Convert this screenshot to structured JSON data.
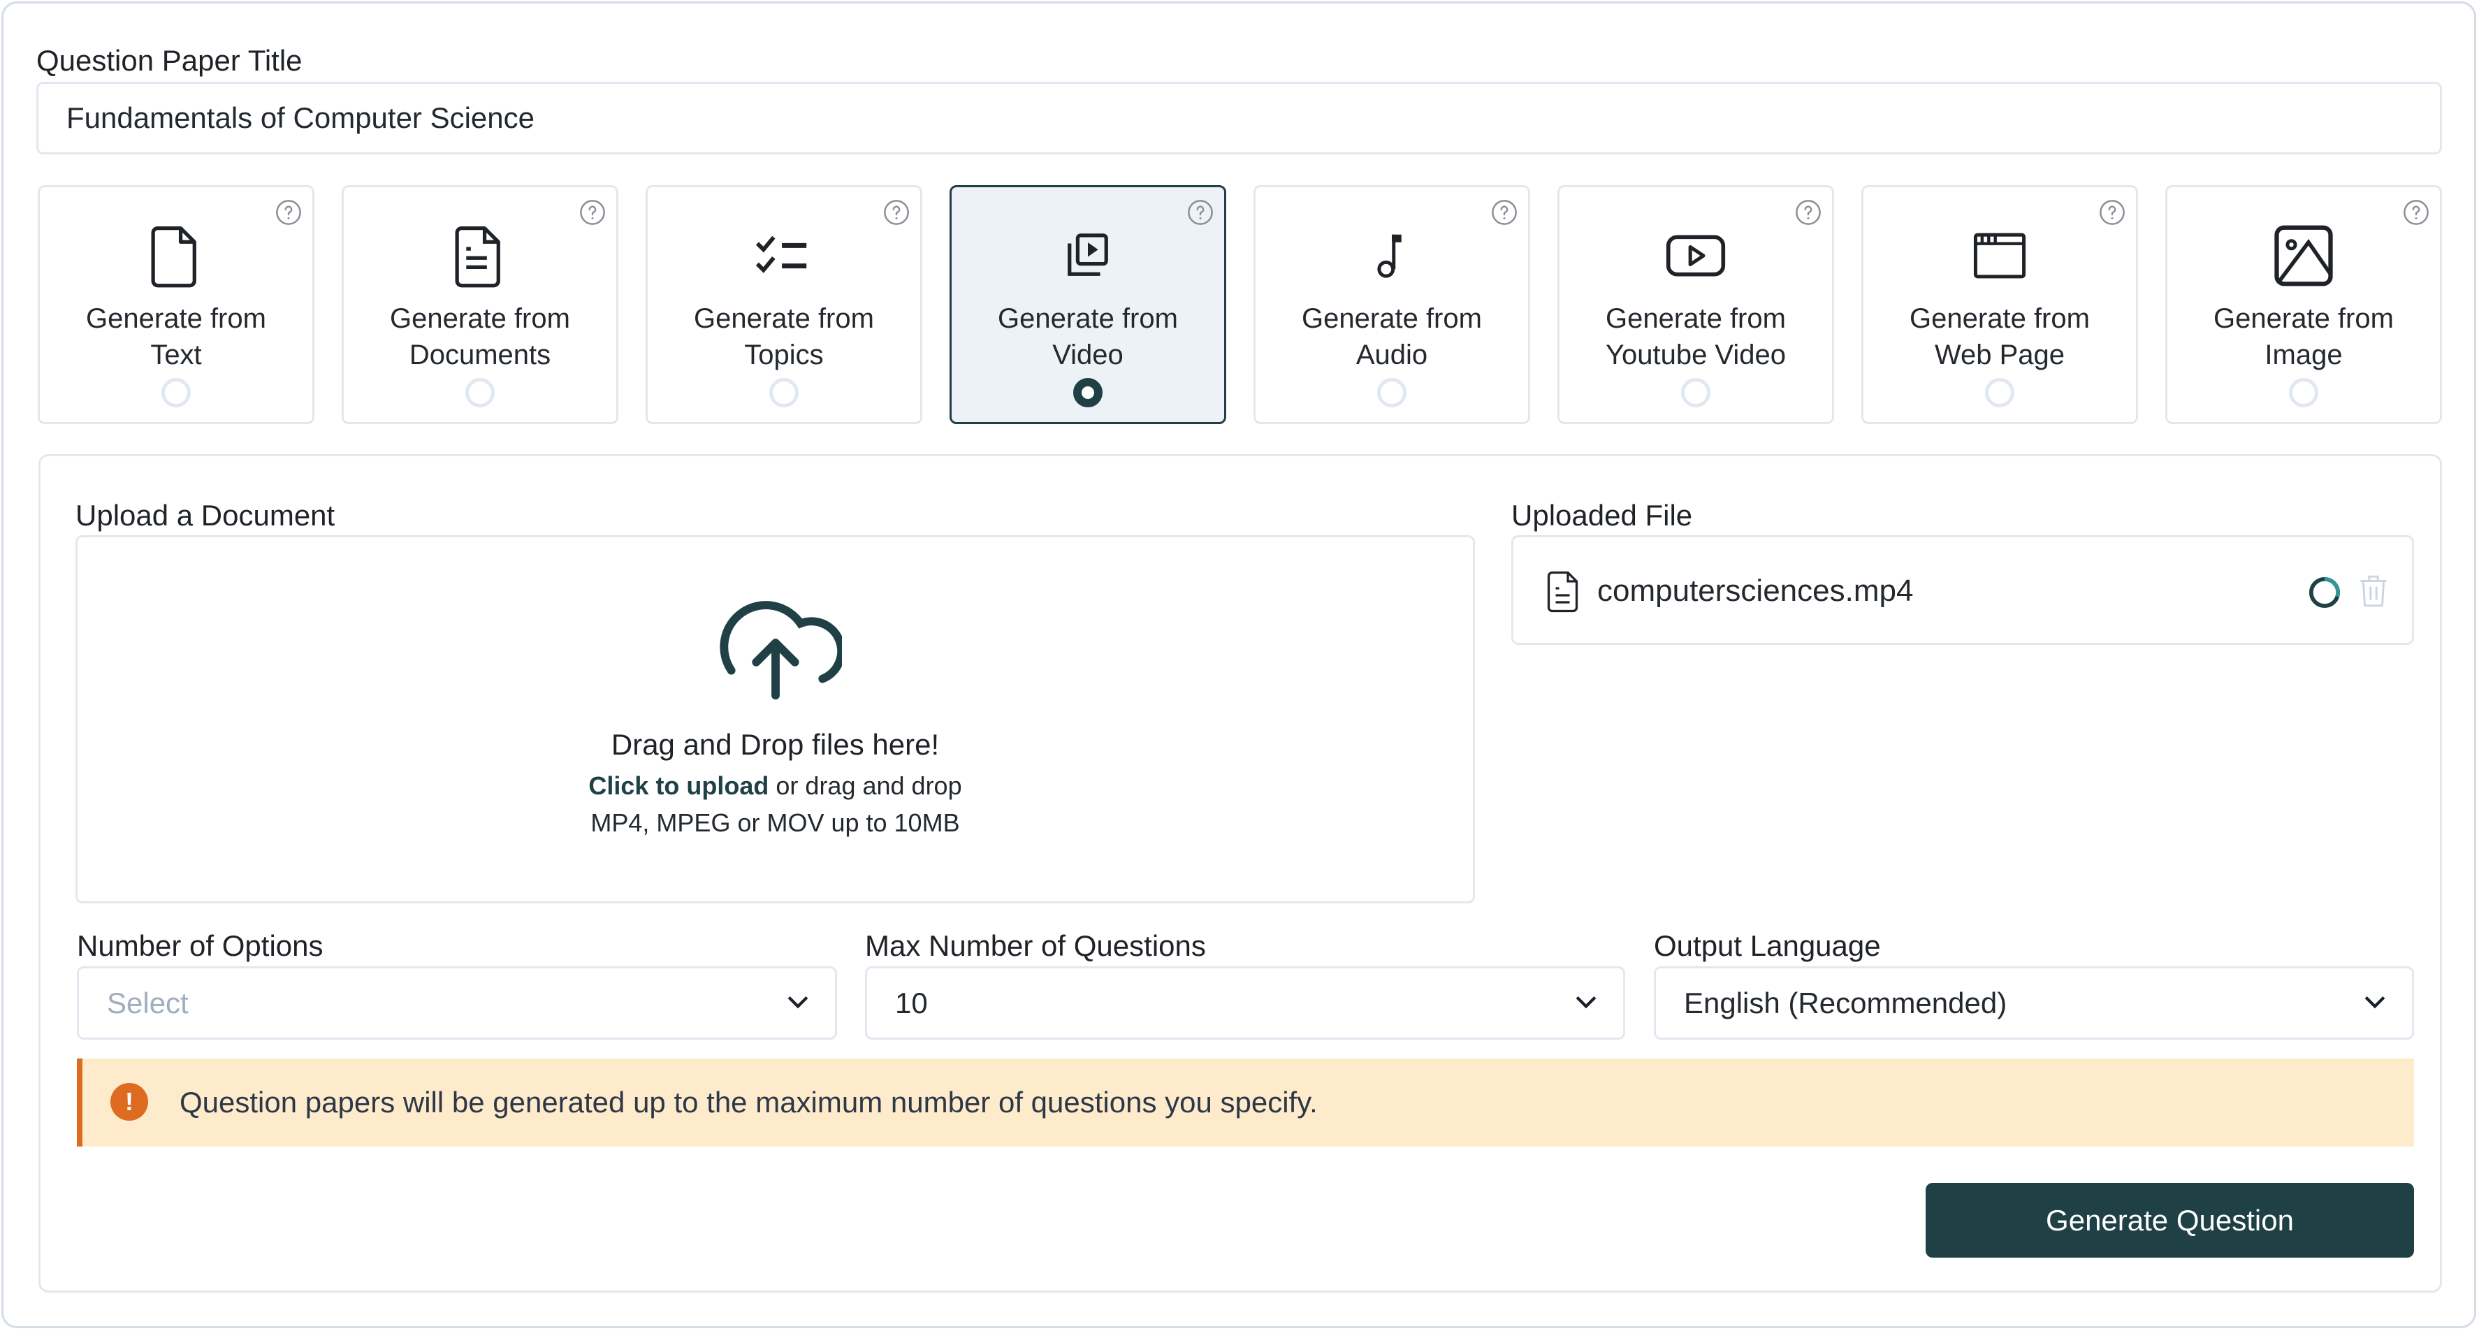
{
  "form": {
    "title_label": "Question Paper Title",
    "title_value": "Fundamentals of Computer Science"
  },
  "sources": [
    {
      "line1": "Generate from",
      "line2": "Text",
      "icon": "file-icon",
      "selected": false
    },
    {
      "line1": "Generate from",
      "line2": "Documents",
      "icon": "document-text-icon",
      "selected": false
    },
    {
      "line1": "Generate from",
      "line2": "Topics",
      "icon": "checklist-icon",
      "selected": false
    },
    {
      "line1": "Generate from",
      "line2": "Video",
      "icon": "video-library-icon",
      "selected": true
    },
    {
      "line1": "Generate from",
      "line2": "Audio",
      "icon": "music-note-icon",
      "selected": false
    },
    {
      "line1": "Generate from",
      "line2": "Youtube Video",
      "icon": "youtube-icon",
      "selected": false
    },
    {
      "line1": "Generate from",
      "line2": "Web Page",
      "icon": "browser-window-icon",
      "selected": false
    },
    {
      "line1": "Generate from",
      "line2": "Image",
      "icon": "image-icon",
      "selected": false
    }
  ],
  "upload": {
    "label": "Upload a Document",
    "title": "Drag and Drop files here!",
    "link_text": "Click to upload",
    "link_suffix": " or drag and drop",
    "formats": "MP4, MPEG or MOV up to 10MB"
  },
  "uploaded": {
    "label": "Uploaded File",
    "file_name": "computersciences.mp4",
    "status": "uploading"
  },
  "options": {
    "num_options": {
      "label": "Number of Options",
      "value": "",
      "placeholder": "Select"
    },
    "max_questions": {
      "label": "Max Number of Questions",
      "value": "10"
    },
    "language": {
      "label": "Output Language",
      "value": "English (Recommended)"
    }
  },
  "alert": {
    "text": "Question papers will be generated up to the maximum number of questions you specify."
  },
  "actions": {
    "generate_label": "Generate Question"
  },
  "colors": {
    "accent": "#1f4045",
    "warning": "#dd6b20",
    "warning_bg": "#feebcb",
    "border": "#e2e8f0"
  }
}
